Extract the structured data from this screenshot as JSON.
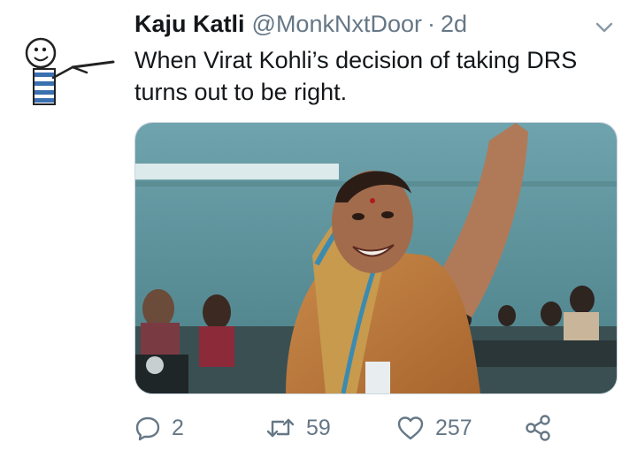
{
  "tweet": {
    "display_name": "Kaju Katli",
    "handle": "@MonkNxtDoor",
    "separator": "·",
    "time": "2d",
    "text": "When Virat Kohli’s decision of taking DRS turns out to be right.",
    "avatar_icon": "stick-figure-avatar-icon",
    "caret_icon": "chevron-down-icon",
    "media": {
      "type": "photo",
      "description_icon": "photo-woman-cheering-in-classroom"
    },
    "actions": {
      "reply_icon": "reply-icon",
      "reply_count": "2",
      "retweet_icon": "retweet-icon",
      "retweet_count": "59",
      "like_icon": "heart-icon",
      "like_count": "257",
      "share_icon": "share-icon"
    }
  },
  "colors": {
    "text_primary": "#14171a",
    "text_secondary": "#657786",
    "border": "#ccd6dd"
  }
}
